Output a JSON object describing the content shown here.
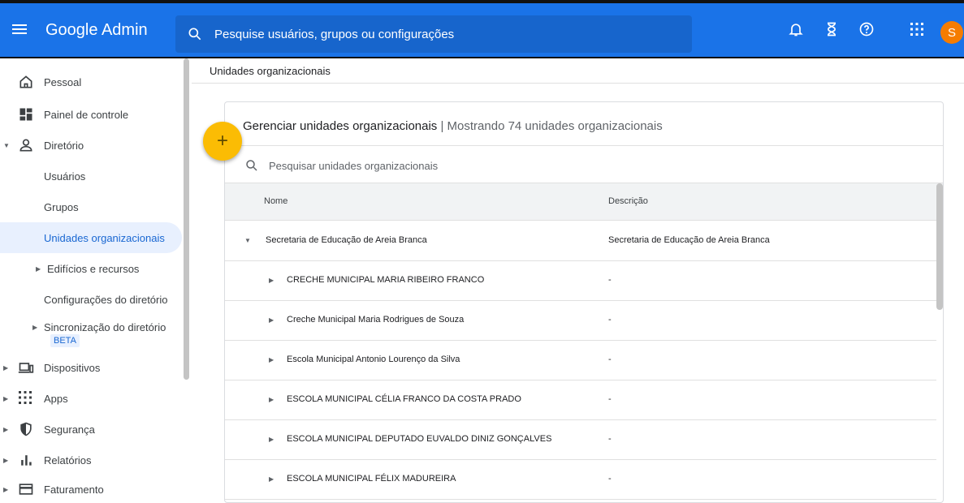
{
  "app": {
    "brand": "Google Admin",
    "avatar_letter": "S",
    "avatar_color": "#f57c00"
  },
  "search": {
    "placeholder": "Pesquise usuários, grupos ou configurações"
  },
  "sidebar": {
    "items": [
      {
        "label": "Pessoal"
      },
      {
        "label": "Painel de controle"
      },
      {
        "label": "Diretório"
      },
      {
        "label": "Usuários"
      },
      {
        "label": "Grupos"
      },
      {
        "label": "Unidades organizacionais"
      },
      {
        "label": "Edifícios e recursos"
      },
      {
        "label": "Configurações do diretório"
      },
      {
        "label": "Sincronização do diretório"
      },
      {
        "label": "Dispositivos"
      },
      {
        "label": "Apps"
      },
      {
        "label": "Segurança"
      },
      {
        "label": "Relatórios"
      },
      {
        "label": "Faturamento"
      }
    ],
    "beta": "BETA"
  },
  "main": {
    "breadcrumb": "Unidades organizacionais",
    "card_title": "Gerenciar unidades organizacionais",
    "card_subtitle": "| Mostrando 74 unidades organizacionais",
    "search_placeholder": "Pesquisar unidades organizacionais",
    "columns": {
      "name": "Nome",
      "description": "Descrição"
    },
    "rows": [
      {
        "name": "Secretaria de Educação de Areia Branca",
        "description": "Secretaria de Educação de Areia Branca"
      },
      {
        "name": "CRECHE MUNICIPAL MARIA RIBEIRO FRANCO",
        "description": "-"
      },
      {
        "name": "Creche Municipal Maria Rodrigues de Souza",
        "description": "-"
      },
      {
        "name": "Escola Municipal Antonio Lourenço da Silva",
        "description": "-"
      },
      {
        "name": "ESCOLA MUNICIPAL CÉLIA FRANCO DA COSTA PRADO",
        "description": "-"
      },
      {
        "name": "ESCOLA MUNICIPAL DEPUTADO EUVALDO DINIZ GONÇALVES",
        "description": "-"
      },
      {
        "name": "ESCOLA MUNICIPAL FÉLIX MADUREIRA",
        "description": "-"
      }
    ]
  },
  "colors": {
    "accent": "#1a73e8",
    "fab": "#fbbc04",
    "active_bg": "#e8f0fe"
  }
}
